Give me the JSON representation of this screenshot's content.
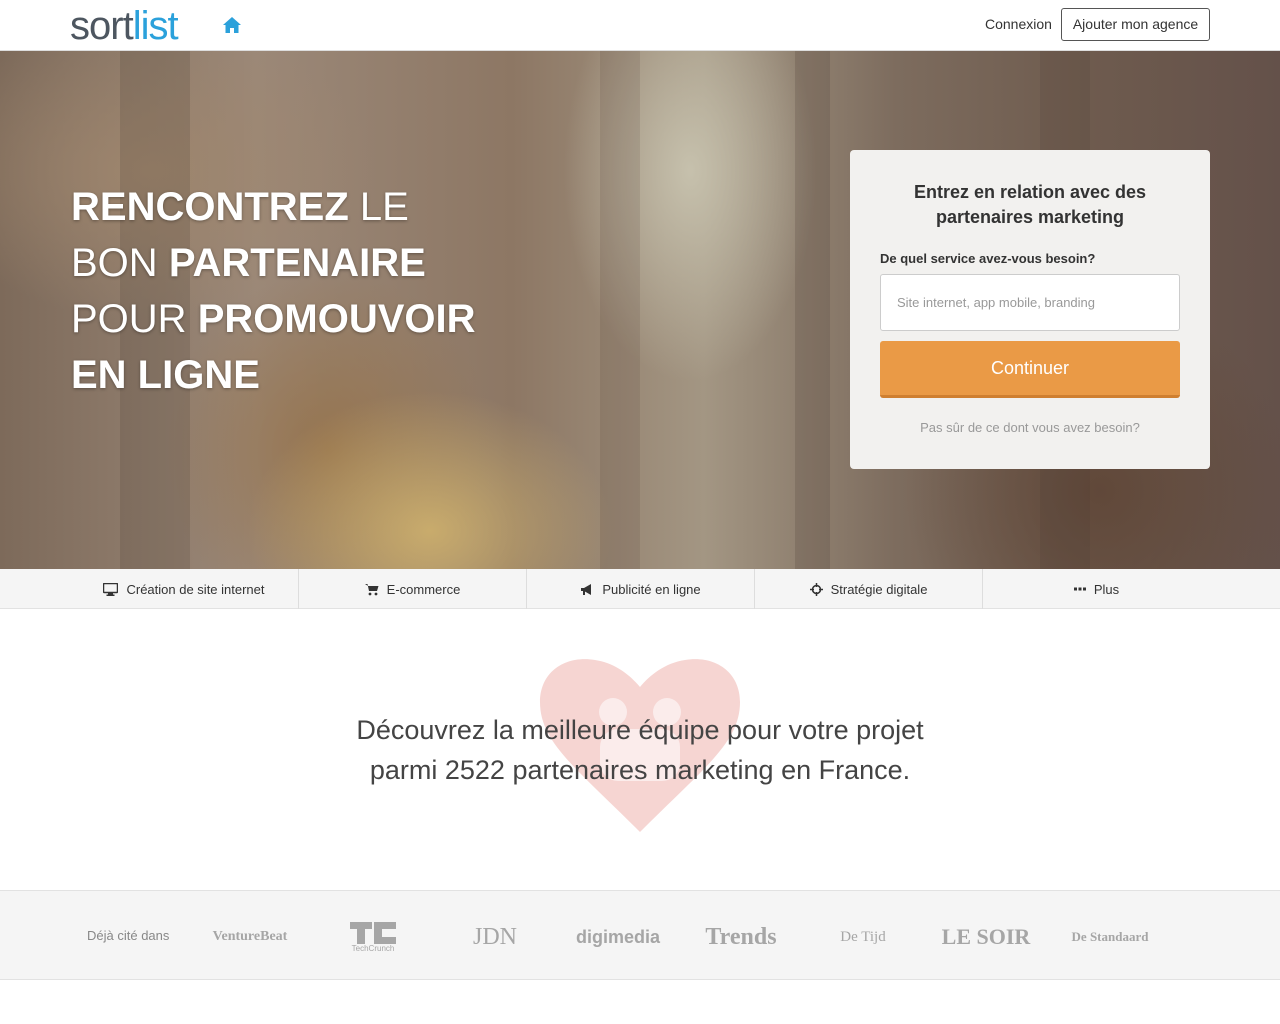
{
  "header": {
    "logo_part1": "sort",
    "logo_part2": "list",
    "login_label": "Connexion",
    "add_agency_label": "Ajouter mon agence"
  },
  "hero": {
    "title": {
      "w1": "RENCONTREZ",
      "w2": "LE",
      "w3": "BON",
      "w4": "PARTENAIRE",
      "w5": "POUR",
      "w6": "PROMOUVOIR",
      "w7": "EN LIGNE"
    },
    "card": {
      "title": "Entrez en relation avec des partenaires marketing",
      "label": "De quel service avez-vous besoin?",
      "input_placeholder": "Site internet, app mobile, branding",
      "button_label": "Continuer",
      "help_link": "Pas sûr de ce dont vous avez besoin?"
    }
  },
  "categories": [
    {
      "label": "Création de site internet",
      "icon": "monitor-icon"
    },
    {
      "label": "E-commerce",
      "icon": "cart-icon"
    },
    {
      "label": "Publicité en ligne",
      "icon": "megaphone-icon"
    },
    {
      "label": "Stratégie digitale",
      "icon": "crosshair-icon"
    },
    {
      "label": "Plus",
      "icon": "ellipsis-icon"
    }
  ],
  "discover": {
    "line1": "Découvrez la meilleure équipe pour votre projet",
    "line2": "parmi 2522 partenaires marketing en France."
  },
  "press": {
    "label": "Déjà cité dans",
    "logos": [
      "VentureBeat",
      "TechCrunch",
      "JDN",
      "digimedia",
      "Trends",
      "De Tijd",
      "LE SOIR",
      "De Standaard"
    ]
  },
  "colors": {
    "accent_blue": "#2ba1db",
    "button_orange": "#ea9a46"
  }
}
